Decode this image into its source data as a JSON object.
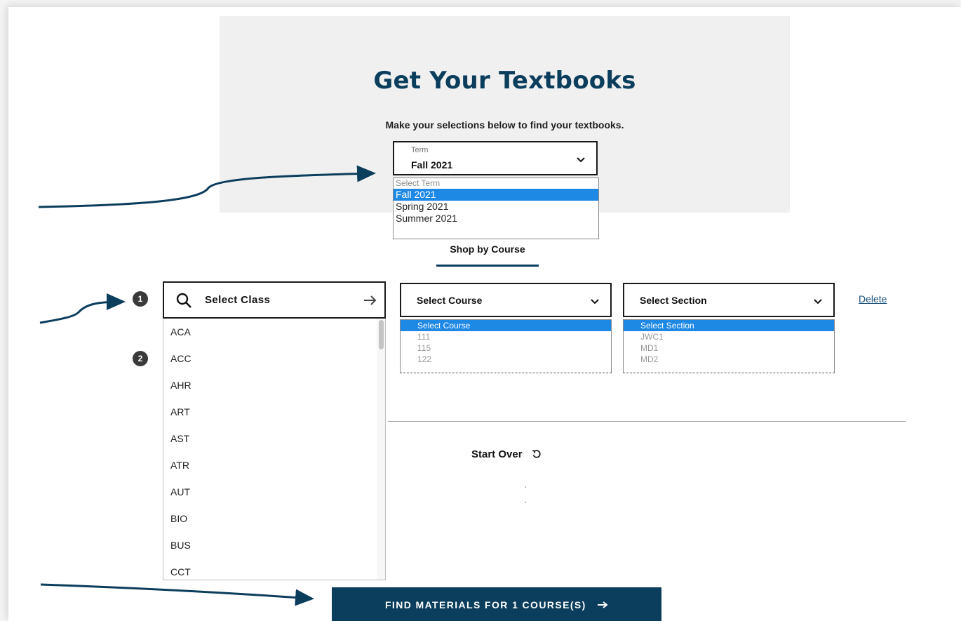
{
  "colors": {
    "brand_navy": "#0b3d5c",
    "selection_blue": "#1e88e5",
    "hero_bg": "#f0f0f0",
    "annotation_arrow": "#0b3d5c"
  },
  "hero": {
    "title": "Get Your Textbooks",
    "subtitle": "Make your selections below to find your textbooks."
  },
  "term": {
    "caption": "Term",
    "value": "Fall 2021",
    "icon": "chevron-down-icon",
    "options": [
      {
        "label": "Select Term",
        "placeholder": true,
        "selected": false
      },
      {
        "label": "Fall 2021",
        "placeholder": false,
        "selected": true
      },
      {
        "label": "Spring 2021",
        "placeholder": false,
        "selected": false
      },
      {
        "label": "Summer 2021",
        "placeholder": false,
        "selected": false
      }
    ]
  },
  "tabs": {
    "shop_by_course": "Shop by Course"
  },
  "steps": [
    "1",
    "2"
  ],
  "class_search": {
    "label": "Select Class",
    "icon": "search-icon",
    "go_icon": "arrow-right-icon",
    "items": [
      "ACA",
      "ACC",
      "AHR",
      "ART",
      "AST",
      "ATR",
      "AUT",
      "BIO",
      "BUS",
      "CCT"
    ]
  },
  "course_select": {
    "label": "Select Course",
    "options": [
      {
        "label": "Select Course",
        "selected": true
      },
      {
        "label": "111",
        "selected": false
      },
      {
        "label": "115",
        "selected": false
      },
      {
        "label": "122",
        "selected": false
      }
    ]
  },
  "section_select": {
    "label": "Select Section",
    "options": [
      {
        "label": "Select Section",
        "selected": true
      },
      {
        "label": "JWC1",
        "selected": false
      },
      {
        "label": "MD1",
        "selected": false
      },
      {
        "label": "MD2",
        "selected": false
      }
    ]
  },
  "actions": {
    "delete": "Delete",
    "start_over": "Start Over",
    "start_over_icon": "refresh-icon",
    "find_materials": "FIND MATERIALS FOR 1 COURSE(S)",
    "find_materials_icon": "arrow-right-icon"
  }
}
